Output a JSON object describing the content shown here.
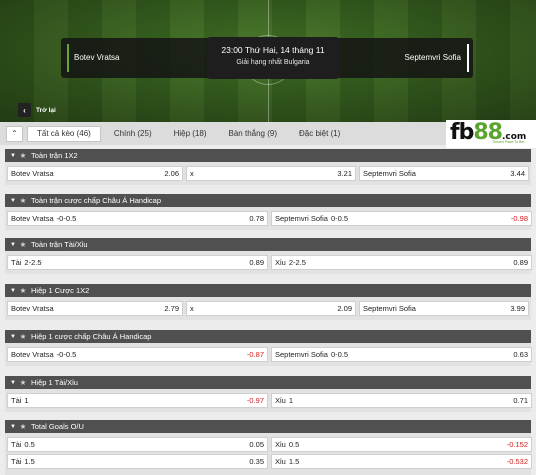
{
  "match": {
    "home": "Botev Vratsa",
    "away": "Septemvri Sofia",
    "time": "23:00 Thứ Hai, 14 tháng 11",
    "league": "Giải hạng nhất Bulgaria"
  },
  "back_label": "Trở lại",
  "tabs": [
    {
      "label": "Tất cả kèo (46)",
      "active": true
    },
    {
      "label": "Chính (25)",
      "active": false
    },
    {
      "label": "Hiệp (18)",
      "active": false
    },
    {
      "label": "Bàn thắng (9)",
      "active": false
    },
    {
      "label": "Đặc biệt (1)",
      "active": false
    }
  ],
  "logo": {
    "brand": "fb",
    "brand_num": "88",
    "domain": ".com",
    "tagline": "Trusted Place To Bet"
  },
  "colors": {
    "accent": "#6ba539",
    "section_header": "#505050",
    "negative": "#d42020"
  },
  "sections": [
    {
      "title": "Toàn trận 1X2",
      "rows": [
        [
          {
            "label": "Botev Vratsa",
            "hc": "",
            "odd": "2.06"
          },
          {
            "label": "x",
            "hc": "",
            "odd": "3.21"
          },
          {
            "label": "Septemvri Sofia",
            "hc": "",
            "odd": "3.44"
          }
        ]
      ]
    },
    {
      "title": "Toàn trận cược chấp Châu Á Handicap",
      "rows": [
        [
          {
            "label": "Botev Vratsa",
            "hc": "-0-0.5",
            "odd": "0.78"
          },
          {
            "label": "Septemvri Sofia",
            "hc": "0-0.5",
            "odd": "-0.98"
          }
        ]
      ]
    },
    {
      "title": "Toàn trận Tài/Xỉu",
      "rows": [
        [
          {
            "label": "Tài",
            "hc": "2-2.5",
            "odd": "0.89"
          },
          {
            "label": "Xỉu",
            "hc": "2-2.5",
            "odd": "0.89"
          }
        ]
      ]
    },
    {
      "title": "Hiệp 1 Cược 1X2",
      "rows": [
        [
          {
            "label": "Botev Vratsa",
            "hc": "",
            "odd": "2.79"
          },
          {
            "label": "x",
            "hc": "",
            "odd": "2.09"
          },
          {
            "label": "Septemvri Sofia",
            "hc": "",
            "odd": "3.99"
          }
        ]
      ]
    },
    {
      "title": "Hiệp 1 cược chấp Châu Á Handicap",
      "rows": [
        [
          {
            "label": "Botev Vratsa",
            "hc": "-0-0.5",
            "odd": "-0.87"
          },
          {
            "label": "Septemvri Sofia",
            "hc": "0-0.5",
            "odd": "0.63"
          }
        ]
      ]
    },
    {
      "title": "Hiệp 1 Tài/Xỉu",
      "rows": [
        [
          {
            "label": "Tài",
            "hc": "1",
            "odd": "-0.97"
          },
          {
            "label": "Xỉu",
            "hc": "1",
            "odd": "0.71"
          }
        ]
      ]
    },
    {
      "title": "Total Goals O/U",
      "rows": [
        [
          {
            "label": "Tài",
            "hc": "0.5",
            "odd": "0.05"
          },
          {
            "label": "Xỉu",
            "hc": "0.5",
            "odd": "-0.152"
          }
        ],
        [
          {
            "label": "Tài",
            "hc": "1.5",
            "odd": "0.35"
          },
          {
            "label": "Xỉu",
            "hc": "1.5",
            "odd": "-0.532"
          }
        ]
      ]
    }
  ]
}
